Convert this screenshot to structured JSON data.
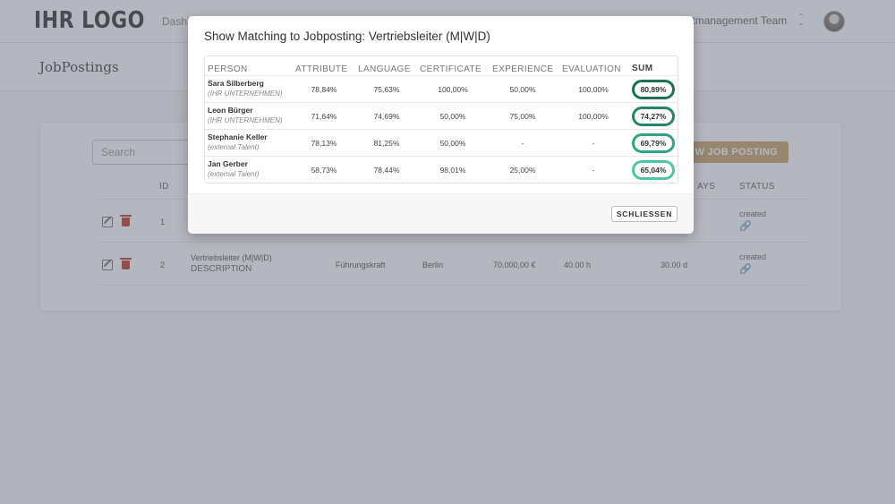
{
  "header": {
    "logo": "IHR LOGO",
    "nav_dashboard": "Dashi",
    "team_select": "entmanagement Team",
    "team_chevron": "⌃\n⌄"
  },
  "page_title": "JobPostings",
  "listing": {
    "search_placeholder": "Search",
    "new_button_label": "W JOB POSTING",
    "columns": {
      "id": "ID",
      "days": "AYS",
      "status": "STATUS"
    },
    "rows": [
      {
        "id": "1",
        "title": "",
        "status": "created"
      },
      {
        "id": "2",
        "title": "Vertriebsleiter (M|W|D)",
        "description": "DESCRIPTION",
        "type": "Führungskraft",
        "location": "Berlin",
        "salary": "70.000,00 €",
        "hours": "40.00 h",
        "days": "30.00 d",
        "status": "created"
      }
    ]
  },
  "modal": {
    "title": "Show Matching to Jobposting: Vertriebsleiter (M|W|D)",
    "headers": {
      "person": "PERSON",
      "attribute": "ATTRIBUTE",
      "language": "LANGUAGE",
      "certificate": "CERTIFICATE",
      "experience": "EXPERIENCE",
      "evaluation": "EVALUATION",
      "sum": "SUM"
    },
    "rows": [
      {
        "name": "Sara Silberberg",
        "company": "(IHR UNTERNEHMEN)",
        "attribute": "78,84%",
        "language": "75,63%",
        "certificate": "100,00%",
        "experience": "50,00%",
        "evaluation": "100,00%",
        "sum": "80,89%",
        "badge_color": "#1f6f55"
      },
      {
        "name": "Leon Bürger",
        "company": "(IHR UNTERNEHMEN)",
        "attribute": "71,64%",
        "language": "74,69%",
        "certificate": "50,00%",
        "experience": "75,00%",
        "evaluation": "100,00%",
        "sum": "74,27%",
        "badge_color": "#24856a"
      },
      {
        "name": "Stephanie Keller",
        "company": "(external Talent)",
        "attribute": "78,13%",
        "language": "81,25%",
        "certificate": "50,00%",
        "experience": "-",
        "evaluation": "-",
        "sum": "69,79%",
        "badge_color": "#2fa383"
      },
      {
        "name": "Jan Gerber",
        "company": "(external Talent)",
        "attribute": "58,73%",
        "language": "78,44%",
        "certificate": "98,01%",
        "experience": "25,00%",
        "evaluation": "-",
        "sum": "65,04%",
        "badge_color": "#4cc6a4"
      }
    ],
    "close_label": "SCHLIESSEN"
  },
  "colors": {
    "accent": "#c9a86a",
    "overlay": "rgba(90,95,115,0.45)"
  }
}
